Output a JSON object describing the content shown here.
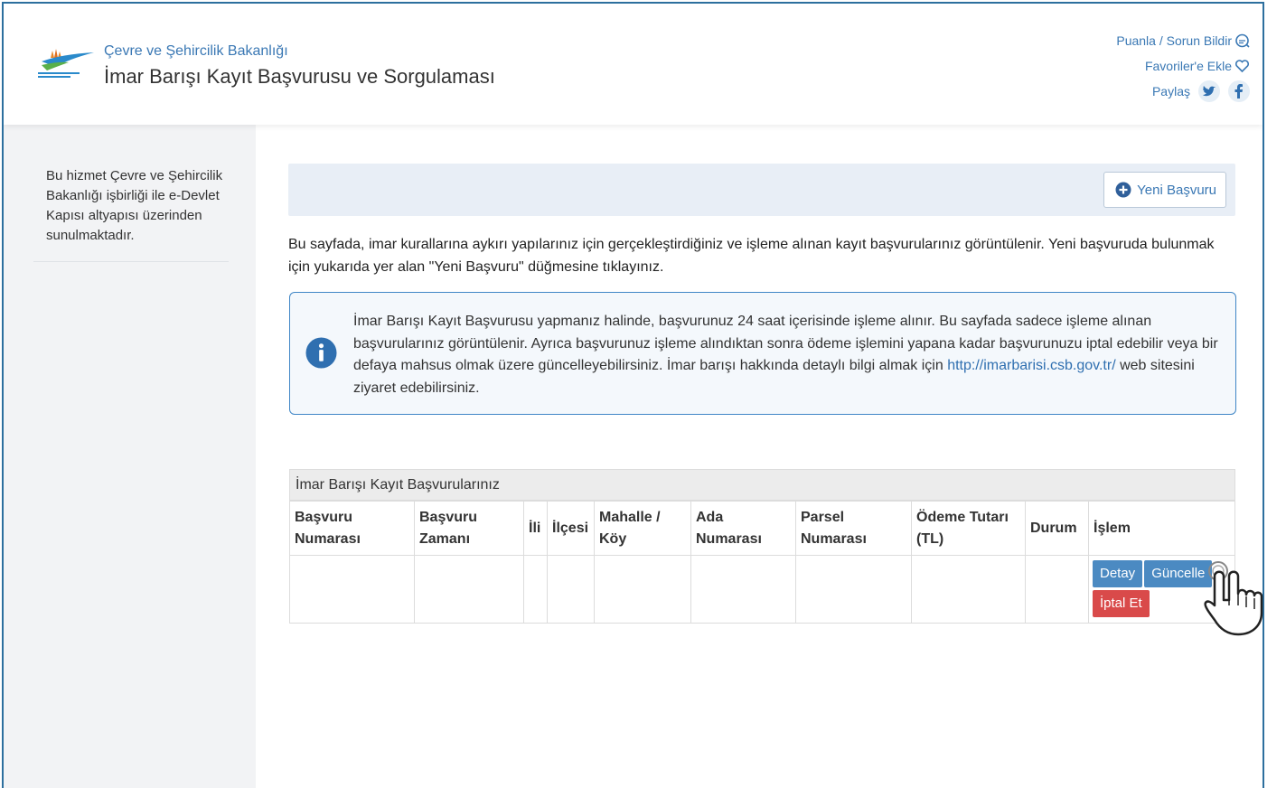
{
  "header": {
    "ministry": "Çevre ve Şehircilik Bakanlığı",
    "service_title": "İmar Barışı Kayıt Başvurusu ve Sorgulaması",
    "rate_link": "Puanla / Sorun Bildir",
    "favorites_link": "Favoriler'e Ekle",
    "share_label": "Paylaş"
  },
  "sidebar": {
    "note": "Bu hizmet Çevre ve Şehircilik Bakanlığı işbirliği ile e-Devlet Kapısı altyapısı üzerinden sunulmaktadır."
  },
  "main": {
    "new_button": "Yeni Başvuru",
    "intro": "Bu sayfada, imar kurallarına aykırı yapılarınız için gerçekleştirdiğiniz ve işleme alınan kayıt başvurularınız görüntülenir. Yeni başvuruda bulunmak için yukarıda yer alan \"Yeni Başvuru\" düğmesine tıklayınız.",
    "alert": {
      "text": "İmar Barışı Kayıt Başvurusu yapmanız halinde, başvurunuz 24 saat içerisinde işleme alınır. Bu sayfada sadece işleme alınan başvurularınız görüntülenir. Ayrıca başvurunuz işleme alındıktan sonra ödeme işlemini yapana kadar başvurunuzu iptal edebilir veya bir defaya mahsus olmak üzere güncelleyebilirsiniz. İmar barışı hakkında detaylı bilgi almak için",
      "link": "http://imarbarisi.csb.gov.tr/",
      "suffix": "web sitesini ziyaret edebilirsiniz."
    },
    "table": {
      "title": "İmar Barışı Kayıt Başvurularınız",
      "columns": [
        "Başvuru Numarası",
        "Başvuru Zamanı",
        "İli",
        "İlçesi",
        "Mahalle / Köy",
        "Ada Numarası",
        "Parsel Numarası",
        "Ödeme Tutarı (TL)",
        "Durum",
        "İşlem"
      ],
      "actions": {
        "detail": "Detay",
        "update": "Güncelle",
        "cancel": "İptal Et"
      }
    }
  },
  "colors": {
    "link": "#3a78b4",
    "frame": "#2d6f9e",
    "action_blue": "#4b8ac2",
    "action_red": "#d94a4a"
  },
  "icons": [
    "ministry-logo",
    "chat-icon",
    "heart-icon",
    "twitter-icon",
    "facebook-icon",
    "plus-circle-icon",
    "info-icon",
    "hand-pointer-icon"
  ]
}
